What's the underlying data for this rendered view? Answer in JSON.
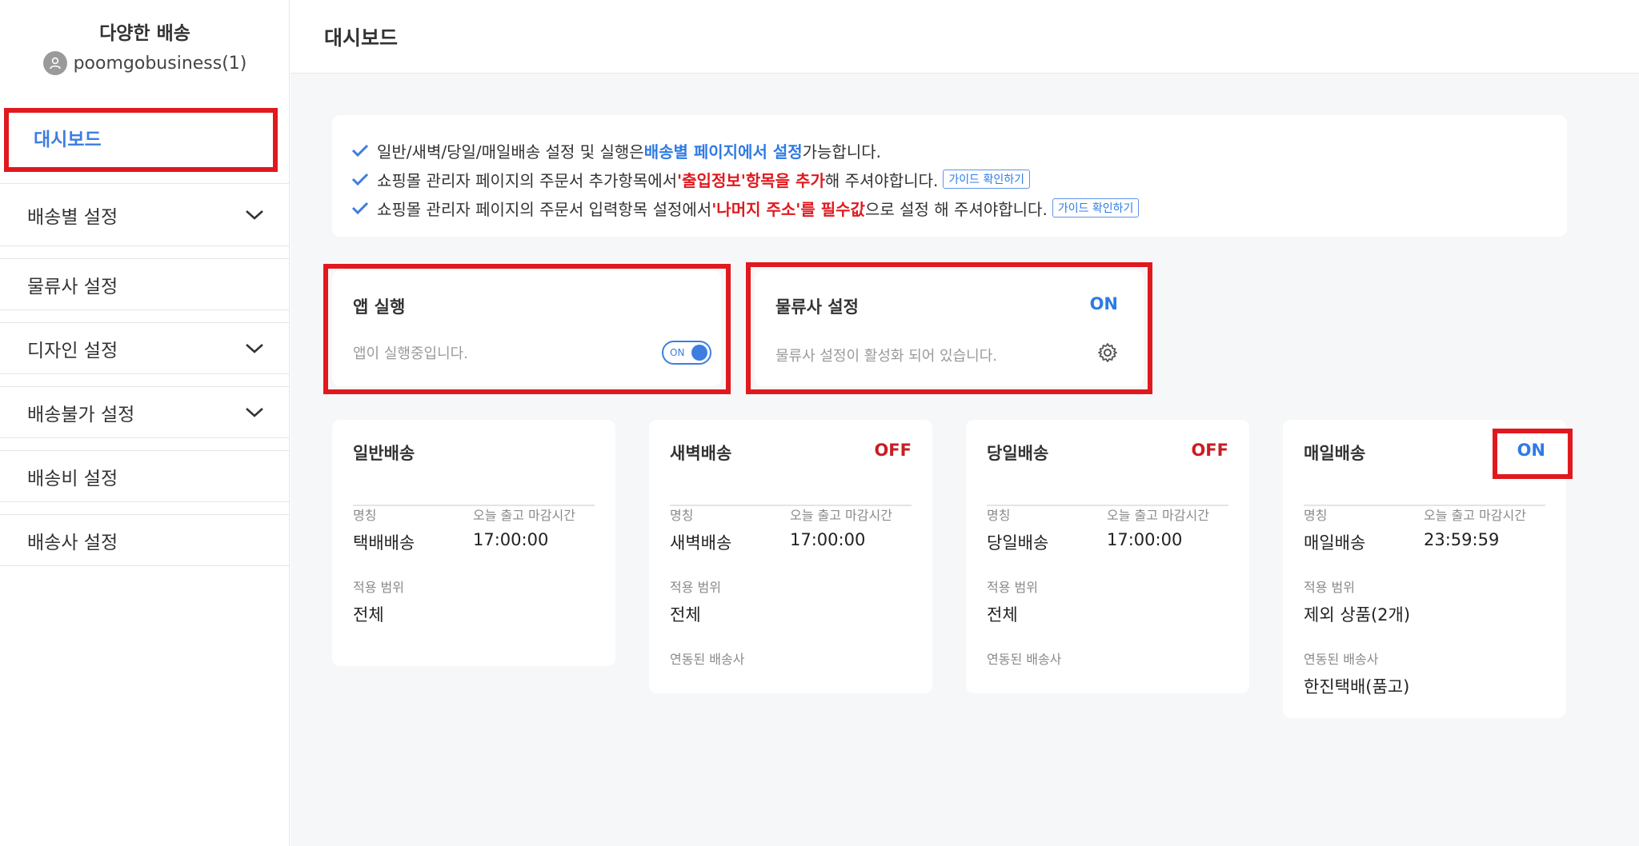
{
  "sidebar": {
    "title": "다양한 배송",
    "user": "poomgobusiness(1)",
    "items": [
      {
        "label": "대시보드"
      },
      {
        "label": "배송별 설정"
      },
      {
        "label": "물류사 설정"
      },
      {
        "label": "디자인 설정"
      },
      {
        "label": "배송불가 설정"
      },
      {
        "label": "배송비 설정"
      },
      {
        "label": "배송사 설정"
      }
    ]
  },
  "header": {
    "title": "대시보드"
  },
  "notice": {
    "line1": {
      "a": "일반/새벽/당일/매일배송 설정 및 실행은 ",
      "b": "배송별 페이지에서 설정",
      "c": " 가능합니다."
    },
    "line2": {
      "a": "쇼핑몰 관리자 페이지의 주문서 추가항목에서 ",
      "b": "'출입정보'항목을 추가",
      "c": " 해 주셔야합니다.",
      "guide": "가이드 확인하기"
    },
    "line3": {
      "a": "쇼핑몰 관리자 페이지의 주문서 입력항목 설정에서 ",
      "b": "'나머지 주소'를 필수값",
      "c": "으로 설정 해 주셔야합니다.",
      "guide": "가이드 확인하기"
    }
  },
  "app_card": {
    "title": "앱 실행",
    "desc": "앱이 실행중입니다.",
    "toggle": "ON"
  },
  "logistics_card": {
    "title": "물류사 설정",
    "status": "ON",
    "desc": "물류사 설정이 활성화 되어 있습니다."
  },
  "labels": {
    "name": "명칭",
    "cutoff": "오늘 출고 마감시간",
    "scope": "적용 범위",
    "carrier": "연동된 배송사"
  },
  "delivery_cards": [
    {
      "title": "일반배송",
      "status": "",
      "name": "택배배송",
      "cutoff": "17:00:00",
      "scope": "전체",
      "carrier": ""
    },
    {
      "title": "새벽배송",
      "status": "OFF",
      "name": "새벽배송",
      "cutoff": "17:00:00",
      "scope": "전체",
      "carrier": ""
    },
    {
      "title": "당일배송",
      "status": "OFF",
      "name": "당일배송",
      "cutoff": "17:00:00",
      "scope": "전체",
      "carrier": ""
    },
    {
      "title": "매일배송",
      "status": "ON",
      "name": "매일배송",
      "cutoff": "23:59:59",
      "scope": "제외 상품(2개)",
      "carrier": "한진택배(품고)"
    }
  ],
  "colors": {
    "accent": "#3d7de0",
    "highlight_red": "#e0191f",
    "off_red": "#c81e24",
    "annotation_box": "#e0191f"
  }
}
